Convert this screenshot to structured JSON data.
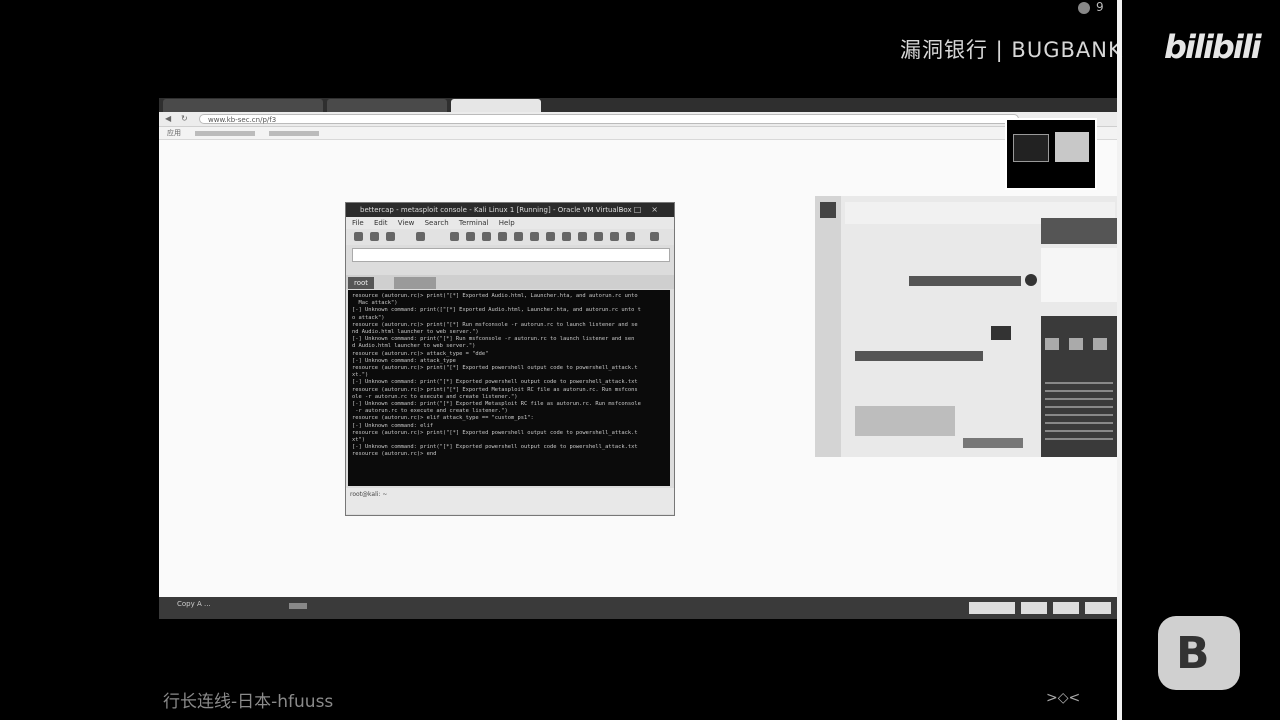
{
  "overlay": {
    "brand_text": "漏洞银行 | BUGBANK",
    "platform_logo": "bilibili",
    "tray_count": "9",
    "caption": "行长连线-日本-hfuuss",
    "b_logo": "B"
  },
  "browser": {
    "url": "www.kb-sec.cn/p/f3",
    "bookmarks": [
      "应用",
      "",
      ""
    ],
    "taskbar_items": [
      "Copy A ...",
      "",
      ""
    ]
  },
  "terminal": {
    "title": "bettercap - metasploit console - Kali Linux 1 [Running] - Oracle VM VirtualBox",
    "menu": [
      "File",
      "Edit",
      "View",
      "Search",
      "Terminal",
      "Help"
    ],
    "tabs": [
      "root",
      ""
    ],
    "lines": [
      "resource (autorun.rc)> print(\"[*] Exported Audio.html, Launcher.hta, and autorun.rc unto",
      "  Mac attack\")",
      "[-] Unknown command: print([\"[*] Exported Audio.html, Launcher.hta, and autorun.rc unto t",
      "o attack\")",
      "resource (autorun.rc)> print(\"[*] Run msfconsole -r autorun.rc to launch listener and se",
      "nd Audio.html launcher to web server.\")",
      "[-] Unknown command: print(\"[*] Run msfconsole -r autorun.rc to launch listener and sen",
      "d Audio.html launcher to web server.\")",
      "resource (autorun.rc)> attack_type = \"dde\"",
      "[-] Unknown command: attack_type",
      "resource (autorun.rc)> print(\"[*] Exported powershell output code to powershell_attack.t",
      "xt.\")",
      "[-] Unknown command: print(\"[*] Exported powershell output code to powershell_attack.txt",
      "",
      "resource (autorun.rc)> print(\"[*] Exported Metasploit RC file as autorun.rc. Run msfcons",
      "ole -r autorun.rc to execute and create listener.\")",
      "[-] Unknown command: print(\"[*] Exported Metasploit RC file as autorun.rc. Run msfconsole",
      " -r autorun.rc to execute and create listener.\")",
      "resource (autorun.rc)> elif attack_type == \"custom_ps1\":",
      "[-] Unknown command: elif",
      "resource (autorun.rc)> print(\"[*] Exported powershell output code to powershell_attack.t",
      "xt\")",
      "[-] Unknown command: print(\"[*] Exported powershell output code to powershell_attack.txt",
      "",
      "resource (autorun.rc)> end"
    ],
    "status": "root@kali: ~"
  },
  "colors": {
    "background": "#000000",
    "browser_bg": "#fafafa",
    "terminal_bg": "#0b0b0b"
  }
}
